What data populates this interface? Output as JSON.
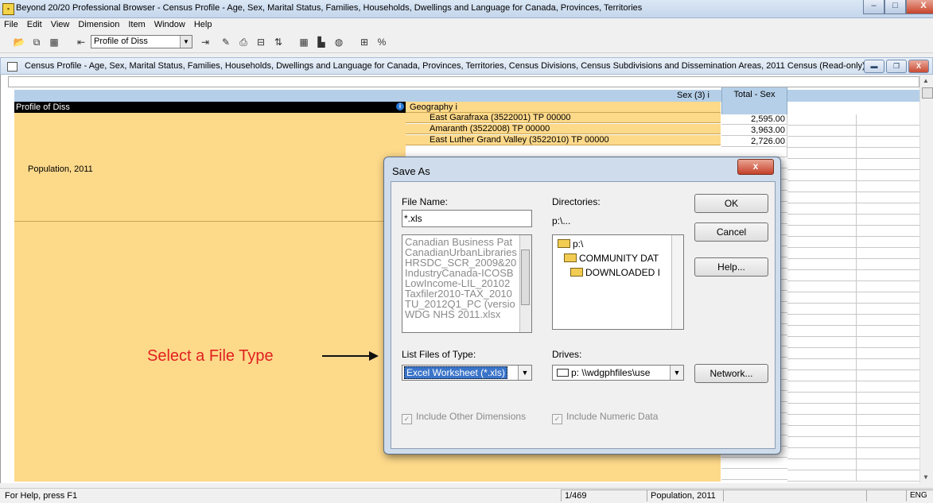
{
  "app": {
    "title": "Beyond 20/20 Professional Browser -  Census Profile - Age, Sex, Marital Status, Families, Households, Dwellings and Language for Canada, Provinces, Territories"
  },
  "menubar": [
    "File",
    "Edit",
    "View",
    "Dimension",
    "Item",
    "Window",
    "Help"
  ],
  "toolbar": {
    "combo_value": "Profile of Diss"
  },
  "child_window": {
    "title": "Census Profile - Age, Sex, Marital Status, Families, Households, Dwellings and Language for Canada, Provinces, Territories, Census Divisions, Census Subdivisions and Dissemination Areas, 2011 Census (Read-only)"
  },
  "table": {
    "row_dimension": "Profile of Diss",
    "row_item": "Population, 2011",
    "column_dimension": "Sex (3)",
    "column_item": "Total - Sex",
    "geo_dimension": "Geography",
    "geography_rows": [
      {
        "name": "East Garafraxa (3522001) TP 00000",
        "value": "2,595.00"
      },
      {
        "name": "Amaranth (3522008) TP 00000",
        "value": "3,963.00"
      },
      {
        "name": "East Luther Grand Valley (3522010) TP 00000",
        "value": "2,726.00"
      }
    ]
  },
  "dialog": {
    "title": "Save As",
    "file_name_label": "File Name:",
    "file_name_value": "*.xls",
    "files": [
      "Canadian Business Pat",
      "CanadianUrbanLibraries",
      "HRSDC_SCR_2009&20",
      "IndustryCanada-ICOSB",
      "LowIncome-LIL_20102",
      "Taxfiler2010-TAX_2010",
      "TU_2012Q1_PC (versio",
      "WDG NHS 2011.xlsx"
    ],
    "directories_label": "Directories:",
    "current_dir": "p:\\...",
    "dirs": [
      "p:\\",
      "COMMUNITY DAT",
      "DOWNLOADED I"
    ],
    "list_type_label": "List Files of Type:",
    "list_type_value": "Excel Worksheet (*.xls)",
    "drives_label": "Drives:",
    "drive_value": "p: \\\\wdgphfiles\\use",
    "ok_label": "OK",
    "cancel_label": "Cancel",
    "help_label": "Help...",
    "network_label": "Network...",
    "chk_other_dims": "Include Other Dimensions",
    "chk_numeric": "Include Numeric Data",
    "close_glyph": "x"
  },
  "annotation": {
    "text": "Select a File Type",
    "color": "#e02020"
  },
  "statusbar": {
    "help": "For Help, press F1",
    "position": "1/469",
    "item": "Population, 2011",
    "lang": "ENG"
  }
}
